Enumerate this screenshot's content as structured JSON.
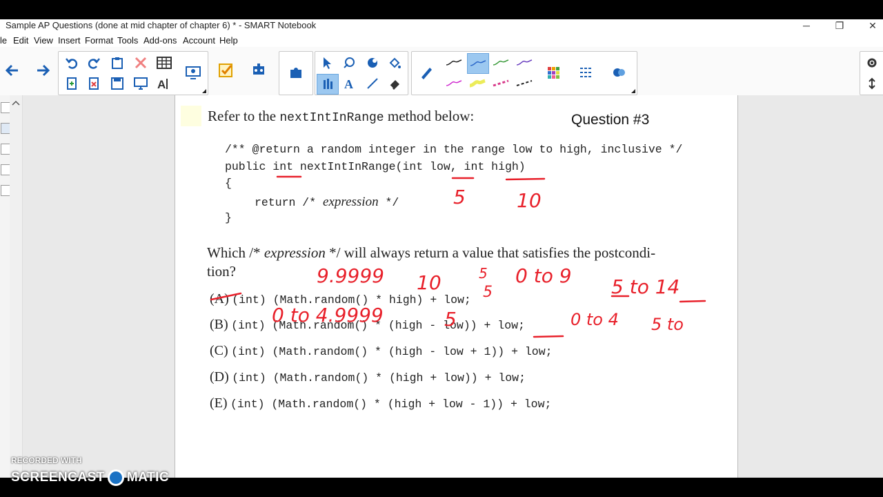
{
  "window": {
    "title": "Sample AP Questions (done at mid chapter of chapter 6) * - SMART Notebook",
    "minimize": "─",
    "restore": "❐",
    "close": "✕"
  },
  "menu": {
    "items": [
      "le",
      "Edit",
      "View",
      "Insert",
      "Format",
      "Tools",
      "Add-ons",
      "Account",
      "Help"
    ]
  },
  "toolbar": {
    "back_icon": "arrow-left-icon",
    "forward_icon": "arrow-right-icon",
    "pen_colors": {
      "black": "#222222",
      "blue": "#2a66c9",
      "green": "#3a9a3a",
      "purple": "#6a3fc0",
      "magenta": "#d02bd0",
      "yellow": "#ecec5a",
      "red": "#d83a8a",
      "selected_bg": "#9cc8f0"
    }
  },
  "question": {
    "prompt_pre": "Refer to the ",
    "prompt_code": "nextIntInRange",
    "prompt_post": " method below:",
    "label": "Question #3",
    "code_line1": "/** @return a random integer in the range low to high, inclusive */",
    "code_line2": "public int nextIntInRange(int low, int high)",
    "code_line3": "{",
    "code_line4_pre": "return /* ",
    "code_line4_em": "expression",
    "code_line4_post": " */",
    "code_line5": "}",
    "ask_pre": "Which /* ",
    "ask_em": "expression",
    "ask_post": " */ will always return a value that satisfies the postcondi-",
    "ask_line2": "tion?",
    "choices": [
      {
        "letter": "(A)",
        "code": "(int) (Math.random() * high) + low;"
      },
      {
        "letter": "(B)",
        "code": "(int) (Math.random() * (high - low)) + low;"
      },
      {
        "letter": "(C)",
        "code": "(int) (Math.random() * (high - low + 1)) + low;"
      },
      {
        "letter": "(D)",
        "code": "(int) (Math.random() * (high + low)) + low;"
      },
      {
        "letter": "(E)",
        "code": "(int) (Math.random() * (high + low - 1)) + low;"
      }
    ]
  },
  "annotations": {
    "ink_color": "#e8202a",
    "low_value": "5",
    "high_value": "10",
    "a_range": "9.9999",
    "a_ten": "10",
    "a_five": "5",
    "a_0to9": "0 to 9",
    "a_5to14": "5 to 14",
    "b_range": "0 to 4.9999",
    "b_five": "5",
    "b_0to4": "0 to 4",
    "b_5to": "5 to"
  },
  "watermark": {
    "recorded": "RECORDED WITH",
    "brand_left": "SCREENCAST",
    "brand_right": "MATIC"
  }
}
